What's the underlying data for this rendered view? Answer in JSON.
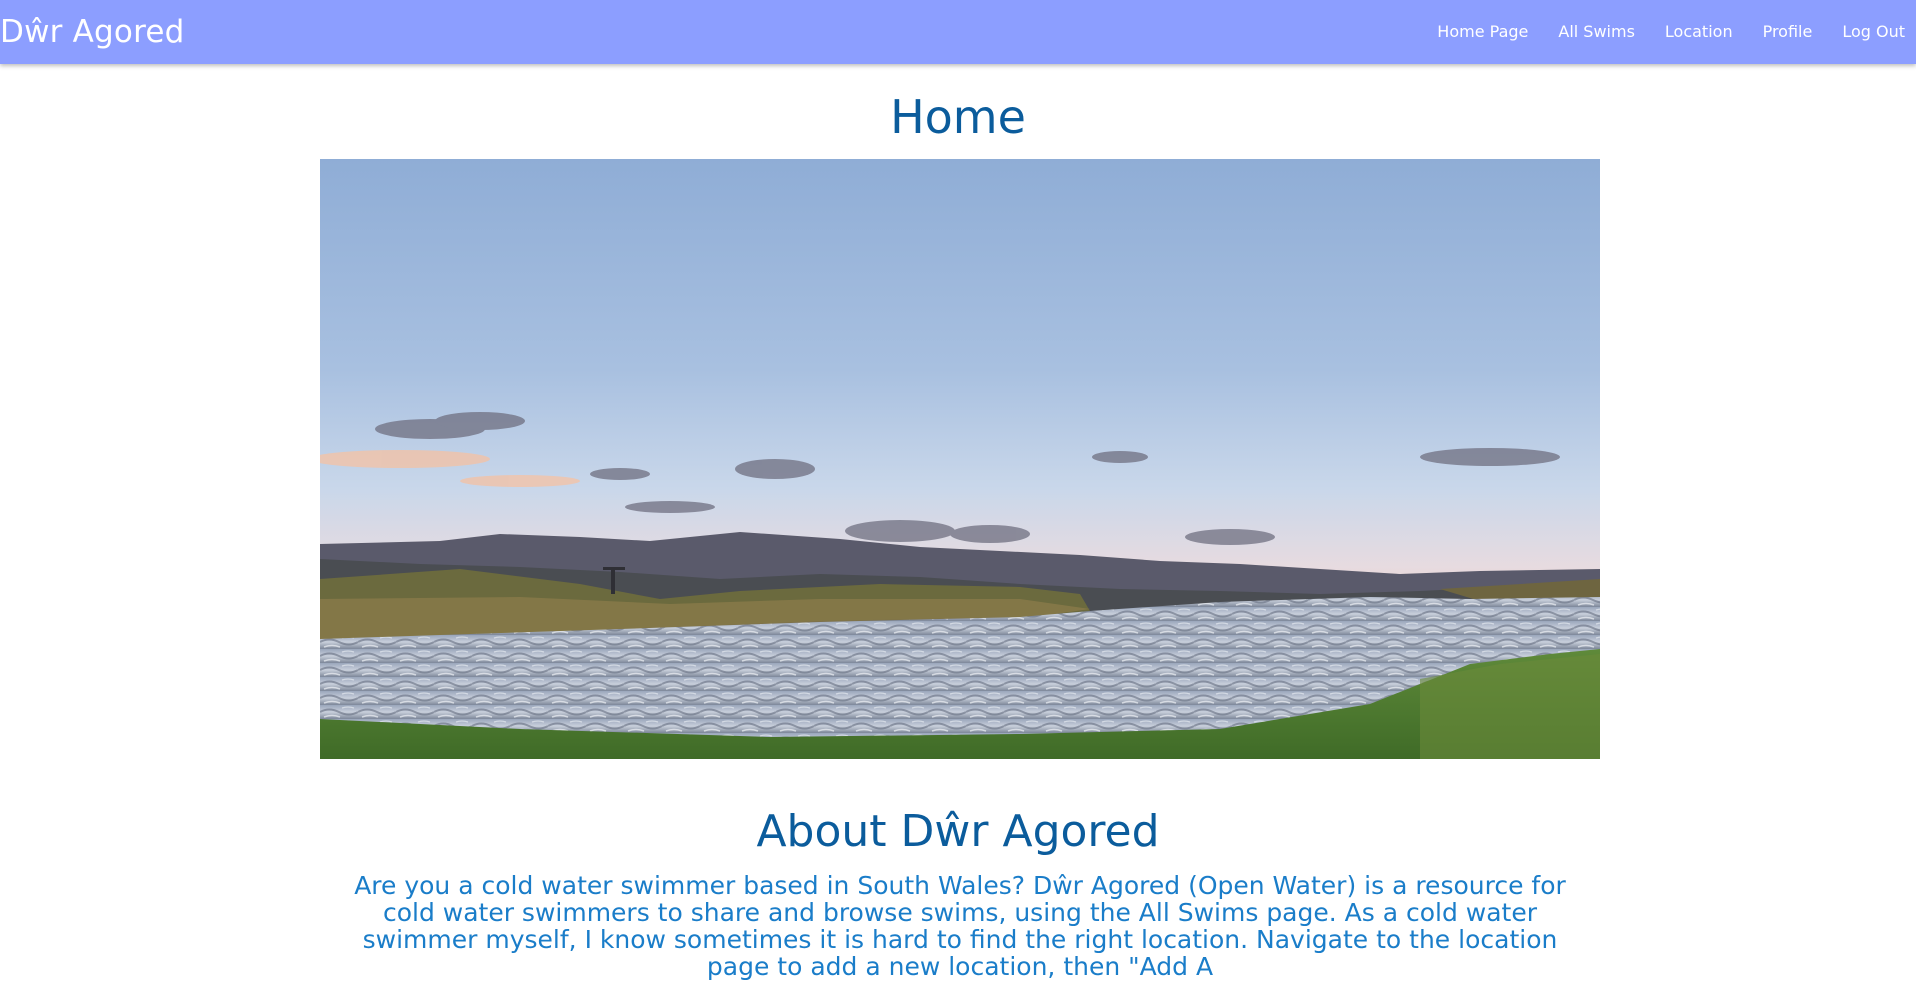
{
  "header": {
    "brand": "Dŵr Agored",
    "nav": [
      {
        "label": "Home Page"
      },
      {
        "label": "All Swims"
      },
      {
        "label": "Location"
      },
      {
        "label": "Profile"
      },
      {
        "label": "Log Out"
      }
    ]
  },
  "main": {
    "title": "Home",
    "about_title": "About Dŵr Agored",
    "about_text": "Are you a cold water swimmer based in South Wales? Dŵr Agored (Open Water) is a resource for cold water swimmers to share and browse swims, using the All Swims page. As a cold water swimmer myself, I know sometimes it is hard to find the right location. Navigate to the location page to add a new location, then \"Add A"
  },
  "colors": {
    "navbar": "#8c9eff",
    "heading": "#0b5c9c",
    "body_text": "#1a7dc9"
  }
}
